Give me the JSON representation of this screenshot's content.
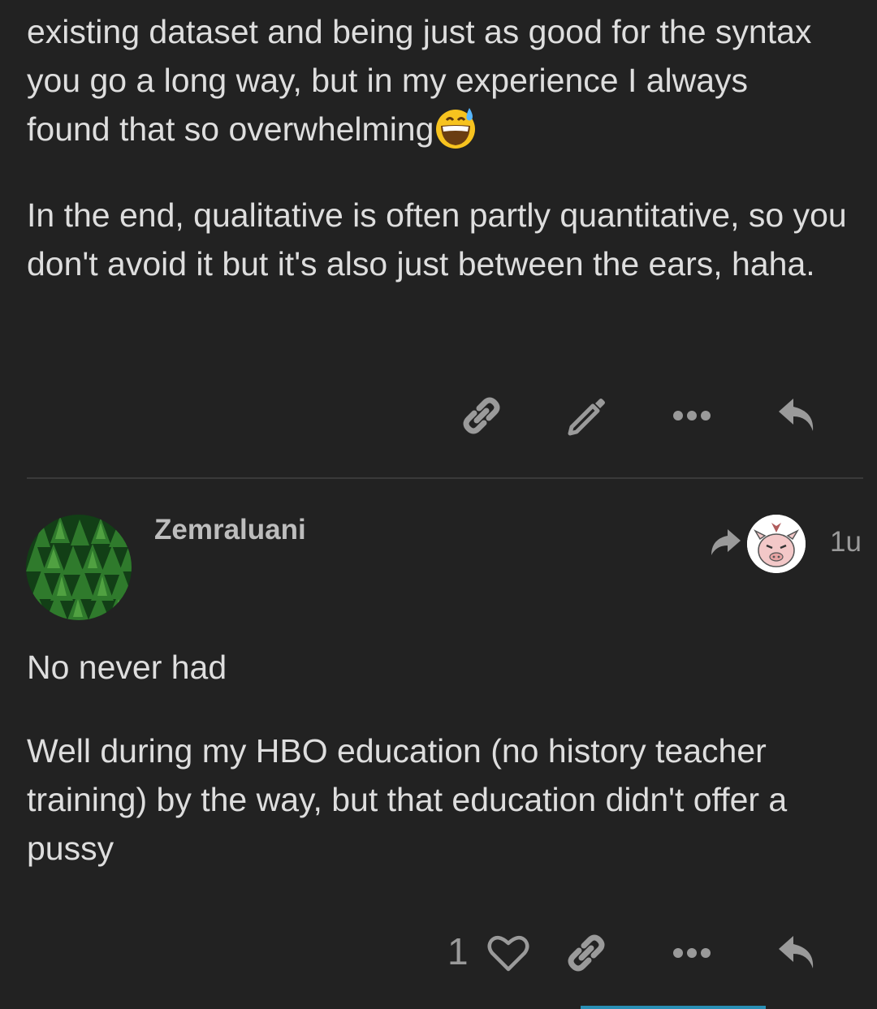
{
  "post1": {
    "lines": [
      "existing dataset and being just as good for the syntax",
      "you go a long way, but in my experience I always",
      "found that so overwhelming"
    ],
    "emoji": "grinning-face-with-sweat",
    "paragraph2": "In the end, qualitative is often partly quantitative, so you don't avoid it but it's also just between the ears, haha.",
    "actions": [
      "link-icon",
      "pencil-icon",
      "more-icon",
      "reply-icon"
    ]
  },
  "post2": {
    "username": "Zemraluani",
    "avatar": "forest-avatar",
    "reply_to_avatar": "pig-avatar",
    "date": "1u",
    "paragraph1": "No never had",
    "paragraph2": "Well during my HBO education (no history teacher training) by the way, but that education didn't offer a pussy",
    "like_count": "1",
    "actions": [
      "heart-icon",
      "link-icon",
      "more-icon",
      "reply-icon"
    ]
  },
  "colors": {
    "background": "#222222",
    "text": "#dedede",
    "icon": "#9a9a9a",
    "accent": "#2a8fb5"
  }
}
